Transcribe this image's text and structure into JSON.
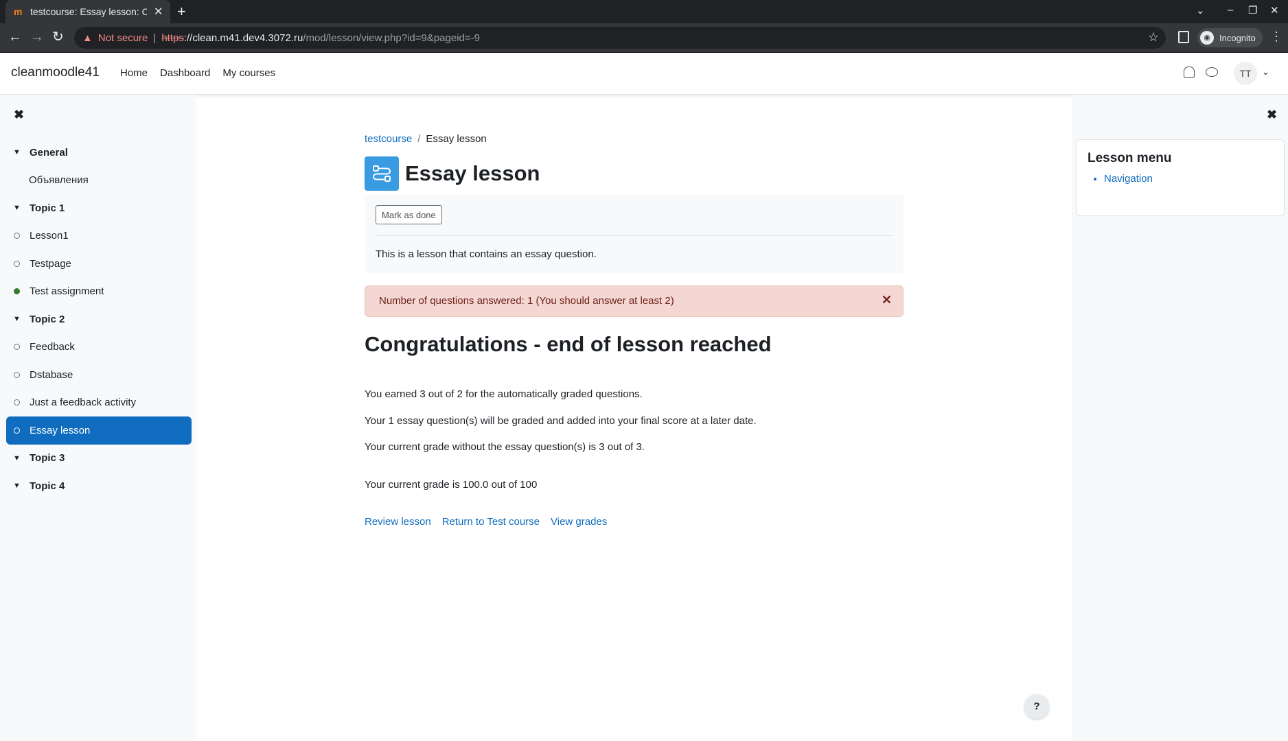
{
  "browser": {
    "tab_title": "testcourse: Essay lesson: Co",
    "favicon": "m",
    "security_label": "Not secure",
    "url_scheme": "https",
    "url_host": "://clean.m41.dev4.3072.ru",
    "url_path": "/mod/lesson/view.php?id=9&pageid=-9",
    "incognito_label": "Incognito"
  },
  "navbar": {
    "brand": "cleanmoodle41",
    "links": [
      "Home",
      "Dashboard",
      "My courses"
    ],
    "avatar_initials": "TT"
  },
  "course_index": [
    {
      "type": "section",
      "label": "General"
    },
    {
      "type": "plain",
      "label": "Объявления"
    },
    {
      "type": "section",
      "label": "Topic 1"
    },
    {
      "type": "activity",
      "label": "Lesson1",
      "done": false
    },
    {
      "type": "activity",
      "label": "Testpage",
      "done": false
    },
    {
      "type": "activity",
      "label": "Test assignment",
      "done": true
    },
    {
      "type": "section",
      "label": "Topic 2"
    },
    {
      "type": "activity",
      "label": "Feedback",
      "done": false
    },
    {
      "type": "activity",
      "label": "Dstabase",
      "done": false
    },
    {
      "type": "activity",
      "label": "Just a feedback activity",
      "done": false
    },
    {
      "type": "activity",
      "label": "Essay lesson",
      "done": false,
      "active": true
    },
    {
      "type": "section",
      "label": "Topic 3"
    },
    {
      "type": "section",
      "label": "Topic 4"
    }
  ],
  "main": {
    "breadcrumb": [
      "testcourse",
      "Essay lesson"
    ],
    "title": "Essay lesson",
    "mark_done_label": "Mark as done",
    "intro": "This is a lesson that contains an essay question.",
    "alert": "Number of questions answered: 1 (You should answer at least 2)",
    "congrats_heading": "Congratulations - end of lesson reached",
    "paragraphs": [
      "You earned 3 out of 2 for the automatically graded questions.",
      "Your 1 essay question(s) will be graded and added into your final score at a later date.",
      "Your current grade without the essay question(s) is 3 out of 3.",
      "Your current grade is 100.0 out of 100"
    ],
    "links": [
      "Review lesson",
      "Return to Test course",
      "View grades"
    ]
  },
  "lesson_menu": {
    "title": "Lesson menu",
    "items": [
      "Navigation"
    ]
  },
  "help_label": "?",
  "colors": {
    "primary": "#0f6cbf",
    "activity_icon": "#399be2",
    "alert_bg": "#f4d6d2",
    "alert_text": "#6e211a",
    "done": "#357a32"
  }
}
